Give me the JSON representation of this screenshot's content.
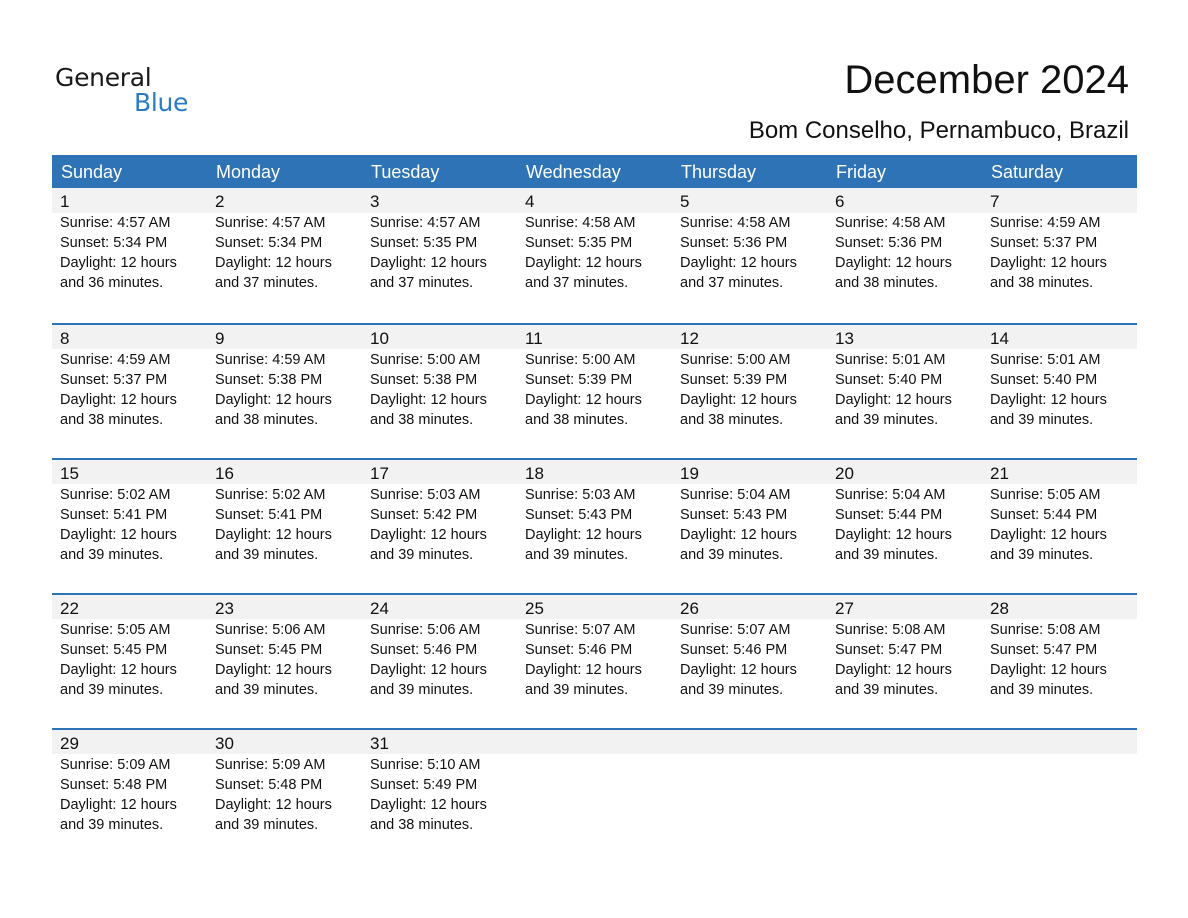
{
  "logo": {
    "word1": "General",
    "word2": "Blue"
  },
  "header": {
    "title": "December 2024",
    "location": "Bom Conselho, Pernambuco, Brazil"
  },
  "colors": {
    "accent": "#2e73b5",
    "logo_blue": "#2a7bc4",
    "date_band": "#f2f2f2"
  },
  "weekdays": [
    "Sunday",
    "Monday",
    "Tuesday",
    "Wednesday",
    "Thursday",
    "Friday",
    "Saturday"
  ],
  "weeks": [
    [
      {
        "day": "1",
        "sunrise": "Sunrise: 4:57 AM",
        "sunset": "Sunset: 5:34 PM",
        "daylight1": "Daylight: 12 hours",
        "daylight2": "and 36 minutes."
      },
      {
        "day": "2",
        "sunrise": "Sunrise: 4:57 AM",
        "sunset": "Sunset: 5:34 PM",
        "daylight1": "Daylight: 12 hours",
        "daylight2": "and 37 minutes."
      },
      {
        "day": "3",
        "sunrise": "Sunrise: 4:57 AM",
        "sunset": "Sunset: 5:35 PM",
        "daylight1": "Daylight: 12 hours",
        "daylight2": "and 37 minutes."
      },
      {
        "day": "4",
        "sunrise": "Sunrise: 4:58 AM",
        "sunset": "Sunset: 5:35 PM",
        "daylight1": "Daylight: 12 hours",
        "daylight2": "and 37 minutes."
      },
      {
        "day": "5",
        "sunrise": "Sunrise: 4:58 AM",
        "sunset": "Sunset: 5:36 PM",
        "daylight1": "Daylight: 12 hours",
        "daylight2": "and 37 minutes."
      },
      {
        "day": "6",
        "sunrise": "Sunrise: 4:58 AM",
        "sunset": "Sunset: 5:36 PM",
        "daylight1": "Daylight: 12 hours",
        "daylight2": "and 38 minutes."
      },
      {
        "day": "7",
        "sunrise": "Sunrise: 4:59 AM",
        "sunset": "Sunset: 5:37 PM",
        "daylight1": "Daylight: 12 hours",
        "daylight2": "and 38 minutes."
      }
    ],
    [
      {
        "day": "8",
        "sunrise": "Sunrise: 4:59 AM",
        "sunset": "Sunset: 5:37 PM",
        "daylight1": "Daylight: 12 hours",
        "daylight2": "and 38 minutes."
      },
      {
        "day": "9",
        "sunrise": "Sunrise: 4:59 AM",
        "sunset": "Sunset: 5:38 PM",
        "daylight1": "Daylight: 12 hours",
        "daylight2": "and 38 minutes."
      },
      {
        "day": "10",
        "sunrise": "Sunrise: 5:00 AM",
        "sunset": "Sunset: 5:38 PM",
        "daylight1": "Daylight: 12 hours",
        "daylight2": "and 38 minutes."
      },
      {
        "day": "11",
        "sunrise": "Sunrise: 5:00 AM",
        "sunset": "Sunset: 5:39 PM",
        "daylight1": "Daylight: 12 hours",
        "daylight2": "and 38 minutes."
      },
      {
        "day": "12",
        "sunrise": "Sunrise: 5:00 AM",
        "sunset": "Sunset: 5:39 PM",
        "daylight1": "Daylight: 12 hours",
        "daylight2": "and 38 minutes."
      },
      {
        "day": "13",
        "sunrise": "Sunrise: 5:01 AM",
        "sunset": "Sunset: 5:40 PM",
        "daylight1": "Daylight: 12 hours",
        "daylight2": "and 39 minutes."
      },
      {
        "day": "14",
        "sunrise": "Sunrise: 5:01 AM",
        "sunset": "Sunset: 5:40 PM",
        "daylight1": "Daylight: 12 hours",
        "daylight2": "and 39 minutes."
      }
    ],
    [
      {
        "day": "15",
        "sunrise": "Sunrise: 5:02 AM",
        "sunset": "Sunset: 5:41 PM",
        "daylight1": "Daylight: 12 hours",
        "daylight2": "and 39 minutes."
      },
      {
        "day": "16",
        "sunrise": "Sunrise: 5:02 AM",
        "sunset": "Sunset: 5:41 PM",
        "daylight1": "Daylight: 12 hours",
        "daylight2": "and 39 minutes."
      },
      {
        "day": "17",
        "sunrise": "Sunrise: 5:03 AM",
        "sunset": "Sunset: 5:42 PM",
        "daylight1": "Daylight: 12 hours",
        "daylight2": "and 39 minutes."
      },
      {
        "day": "18",
        "sunrise": "Sunrise: 5:03 AM",
        "sunset": "Sunset: 5:43 PM",
        "daylight1": "Daylight: 12 hours",
        "daylight2": "and 39 minutes."
      },
      {
        "day": "19",
        "sunrise": "Sunrise: 5:04 AM",
        "sunset": "Sunset: 5:43 PM",
        "daylight1": "Daylight: 12 hours",
        "daylight2": "and 39 minutes."
      },
      {
        "day": "20",
        "sunrise": "Sunrise: 5:04 AM",
        "sunset": "Sunset: 5:44 PM",
        "daylight1": "Daylight: 12 hours",
        "daylight2": "and 39 minutes."
      },
      {
        "day": "21",
        "sunrise": "Sunrise: 5:05 AM",
        "sunset": "Sunset: 5:44 PM",
        "daylight1": "Daylight: 12 hours",
        "daylight2": "and 39 minutes."
      }
    ],
    [
      {
        "day": "22",
        "sunrise": "Sunrise: 5:05 AM",
        "sunset": "Sunset: 5:45 PM",
        "daylight1": "Daylight: 12 hours",
        "daylight2": "and 39 minutes."
      },
      {
        "day": "23",
        "sunrise": "Sunrise: 5:06 AM",
        "sunset": "Sunset: 5:45 PM",
        "daylight1": "Daylight: 12 hours",
        "daylight2": "and 39 minutes."
      },
      {
        "day": "24",
        "sunrise": "Sunrise: 5:06 AM",
        "sunset": "Sunset: 5:46 PM",
        "daylight1": "Daylight: 12 hours",
        "daylight2": "and 39 minutes."
      },
      {
        "day": "25",
        "sunrise": "Sunrise: 5:07 AM",
        "sunset": "Sunset: 5:46 PM",
        "daylight1": "Daylight: 12 hours",
        "daylight2": "and 39 minutes."
      },
      {
        "day": "26",
        "sunrise": "Sunrise: 5:07 AM",
        "sunset": "Sunset: 5:46 PM",
        "daylight1": "Daylight: 12 hours",
        "daylight2": "and 39 minutes."
      },
      {
        "day": "27",
        "sunrise": "Sunrise: 5:08 AM",
        "sunset": "Sunset: 5:47 PM",
        "daylight1": "Daylight: 12 hours",
        "daylight2": "and 39 minutes."
      },
      {
        "day": "28",
        "sunrise": "Sunrise: 5:08 AM",
        "sunset": "Sunset: 5:47 PM",
        "daylight1": "Daylight: 12 hours",
        "daylight2": "and 39 minutes."
      }
    ],
    [
      {
        "day": "29",
        "sunrise": "Sunrise: 5:09 AM",
        "sunset": "Sunset: 5:48 PM",
        "daylight1": "Daylight: 12 hours",
        "daylight2": "and 39 minutes."
      },
      {
        "day": "30",
        "sunrise": "Sunrise: 5:09 AM",
        "sunset": "Sunset: 5:48 PM",
        "daylight1": "Daylight: 12 hours",
        "daylight2": "and 39 minutes."
      },
      {
        "day": "31",
        "sunrise": "Sunrise: 5:10 AM",
        "sunset": "Sunset: 5:49 PM",
        "daylight1": "Daylight: 12 hours",
        "daylight2": "and 38 minutes."
      },
      {
        "day": "",
        "sunrise": "",
        "sunset": "",
        "daylight1": "",
        "daylight2": ""
      },
      {
        "day": "",
        "sunrise": "",
        "sunset": "",
        "daylight1": "",
        "daylight2": ""
      },
      {
        "day": "",
        "sunrise": "",
        "sunset": "",
        "daylight1": "",
        "daylight2": ""
      },
      {
        "day": "",
        "sunrise": "",
        "sunset": "",
        "daylight1": "",
        "daylight2": ""
      }
    ]
  ]
}
